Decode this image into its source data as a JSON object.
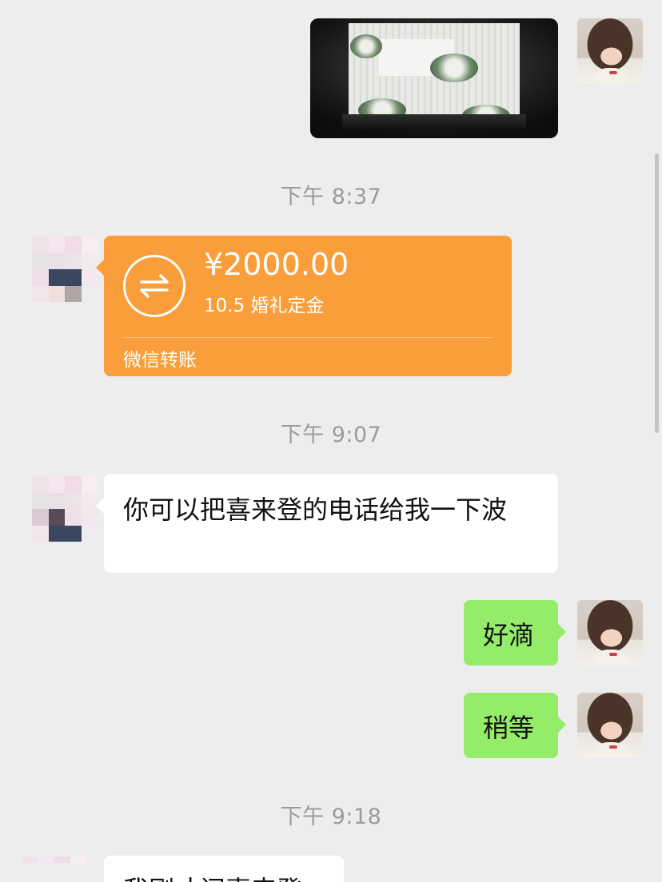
{
  "messages": {
    "time_1": "下午 8:37",
    "transfer": {
      "amount": "¥2000.00",
      "note": "10.5 婚礼定金",
      "footer": "微信转账"
    },
    "time_2": "下午 9:07",
    "msg_1": "你可以把喜来登的电话给我一下波",
    "msg_2": "好滴",
    "msg_3": "稍等",
    "time_3": "下午 9:18",
    "msg_4_partial": "我刚才问喜来登"
  },
  "icons": {
    "transfer": "transfer-arrows-icon"
  },
  "colors": {
    "background": "#ededed",
    "transfer_orange": "#fa9d3b",
    "self_bubble_green": "#95ec69",
    "other_bubble_white": "#ffffff"
  }
}
